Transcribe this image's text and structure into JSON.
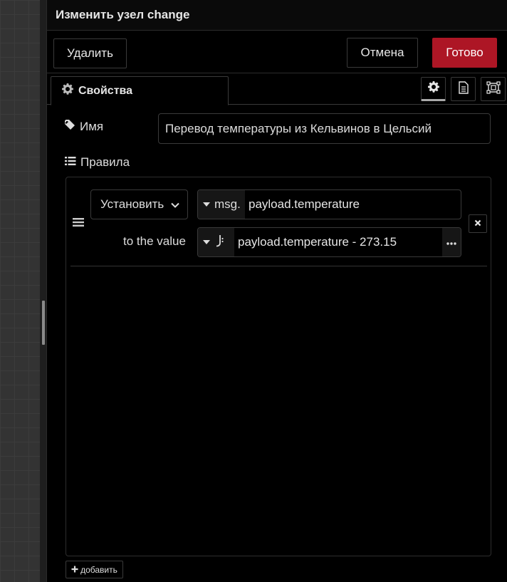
{
  "header": {
    "title": "Изменить узел change"
  },
  "toolbar": {
    "delete_label": "Удалить",
    "cancel_label": "Отмена",
    "done_label": "Готово"
  },
  "tabs": {
    "properties_label": "Свойства"
  },
  "form": {
    "name_label": "Имя",
    "name_value": "Перевод температуры из Кельвинов в Цельсий",
    "rules_label": "Правила"
  },
  "rule": {
    "action": "Установить",
    "target_type": "msg.",
    "target_value": "payload.temperature",
    "to_value_label": "to the value",
    "value_type_icon": "jsonata-icon",
    "value_expression": "payload.temperature - 273.15"
  },
  "add_label": "добавить",
  "colors": {
    "done_button": "#ad1625",
    "background": "#000000",
    "border": "#3a3a3a"
  }
}
